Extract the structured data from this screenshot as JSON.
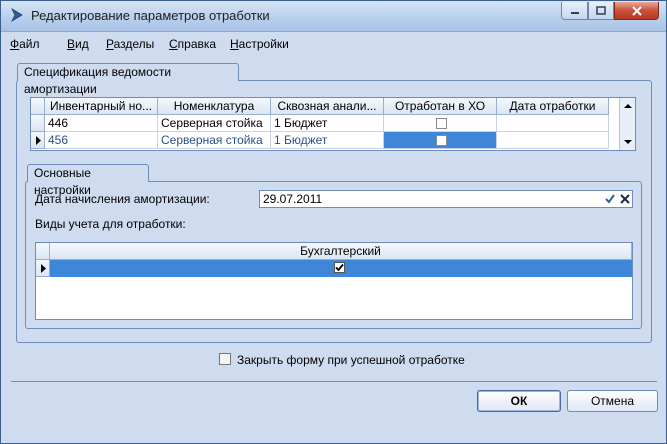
{
  "window": {
    "title": "Редактирование параметров отработки"
  },
  "menu": [
    {
      "label": "Файл",
      "u": "Ф",
      "rest": "айл"
    },
    {
      "label": "Вид",
      "u": "В",
      "rest": "ид"
    },
    {
      "label": "Разделы",
      "u": "Р",
      "rest": "азделы"
    },
    {
      "label": "Справка",
      "u": "С",
      "rest": "правка"
    },
    {
      "label": "Настройки",
      "u": "Н",
      "rest": "астройки"
    }
  ],
  "spec_tab": {
    "label": "Спецификация ведомости амортизации"
  },
  "spec_grid": {
    "columns": [
      "Инвентарный но...",
      "Номенклатура",
      "Сквозная анали...",
      "Отработан в ХО",
      "Дата отработки"
    ],
    "rows": [
      {
        "inv": "446",
        "nom": "Серверная стойка",
        "anal": "1 Бюджет",
        "processed": false,
        "date": "",
        "current": false
      },
      {
        "inv": "456",
        "nom": "Серверная стойка",
        "anal": "1 Бюджет",
        "processed": false,
        "date": "",
        "current": true
      }
    ]
  },
  "settings_tab": {
    "label": "Основные настройки"
  },
  "settings": {
    "amort_date_label": "Дата начисления амортизации:",
    "amort_date_value": "29.07.2011",
    "accounting_types_label": "Виды учета для отработки:"
  },
  "types_grid": {
    "column": "Бухгалтерский",
    "rows": [
      {
        "checked": true,
        "current": true
      }
    ]
  },
  "close_on_success": {
    "label": "Закрыть форму при успешной отработке",
    "checked": false
  },
  "buttons": {
    "ok": "ОК",
    "cancel": "Отмена"
  },
  "colors": {
    "selection": "#3d86d8",
    "window_bg": "#cfdcf0",
    "border": "#6f8db8"
  }
}
